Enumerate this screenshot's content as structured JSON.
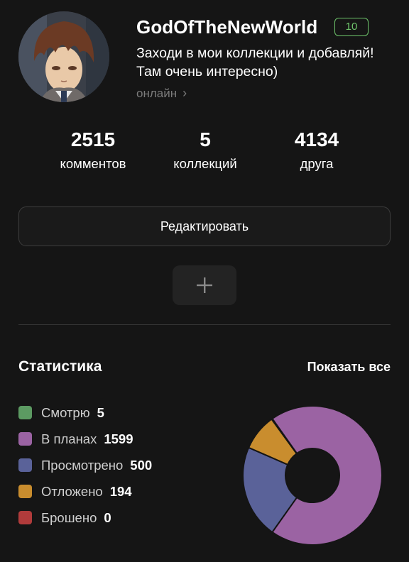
{
  "profile": {
    "username": "GodOfTheNewWorld",
    "level": "10",
    "bio": "Заходи в мои коллекции и добавляй! Там очень интересно)",
    "status": "онлайн"
  },
  "stats": [
    {
      "value": "2515",
      "label": "комментов"
    },
    {
      "value": "5",
      "label": "коллекций"
    },
    {
      "value": "4134",
      "label": "друга"
    }
  ],
  "actions": {
    "edit_label": "Редактировать",
    "add_icon": "plus-icon"
  },
  "statistics": {
    "title": "Статистика",
    "show_all": "Показать все"
  },
  "chart_data": {
    "type": "pie",
    "donut": true,
    "categories": [
      "Смотрю",
      "В планах",
      "Просмотрено",
      "Отложено",
      "Брошено"
    ],
    "values": [
      5,
      1599,
      500,
      194,
      0
    ],
    "colors": [
      "#5c9a62",
      "#9b63a3",
      "#5a6299",
      "#c98d2e",
      "#b13b3b"
    ]
  }
}
